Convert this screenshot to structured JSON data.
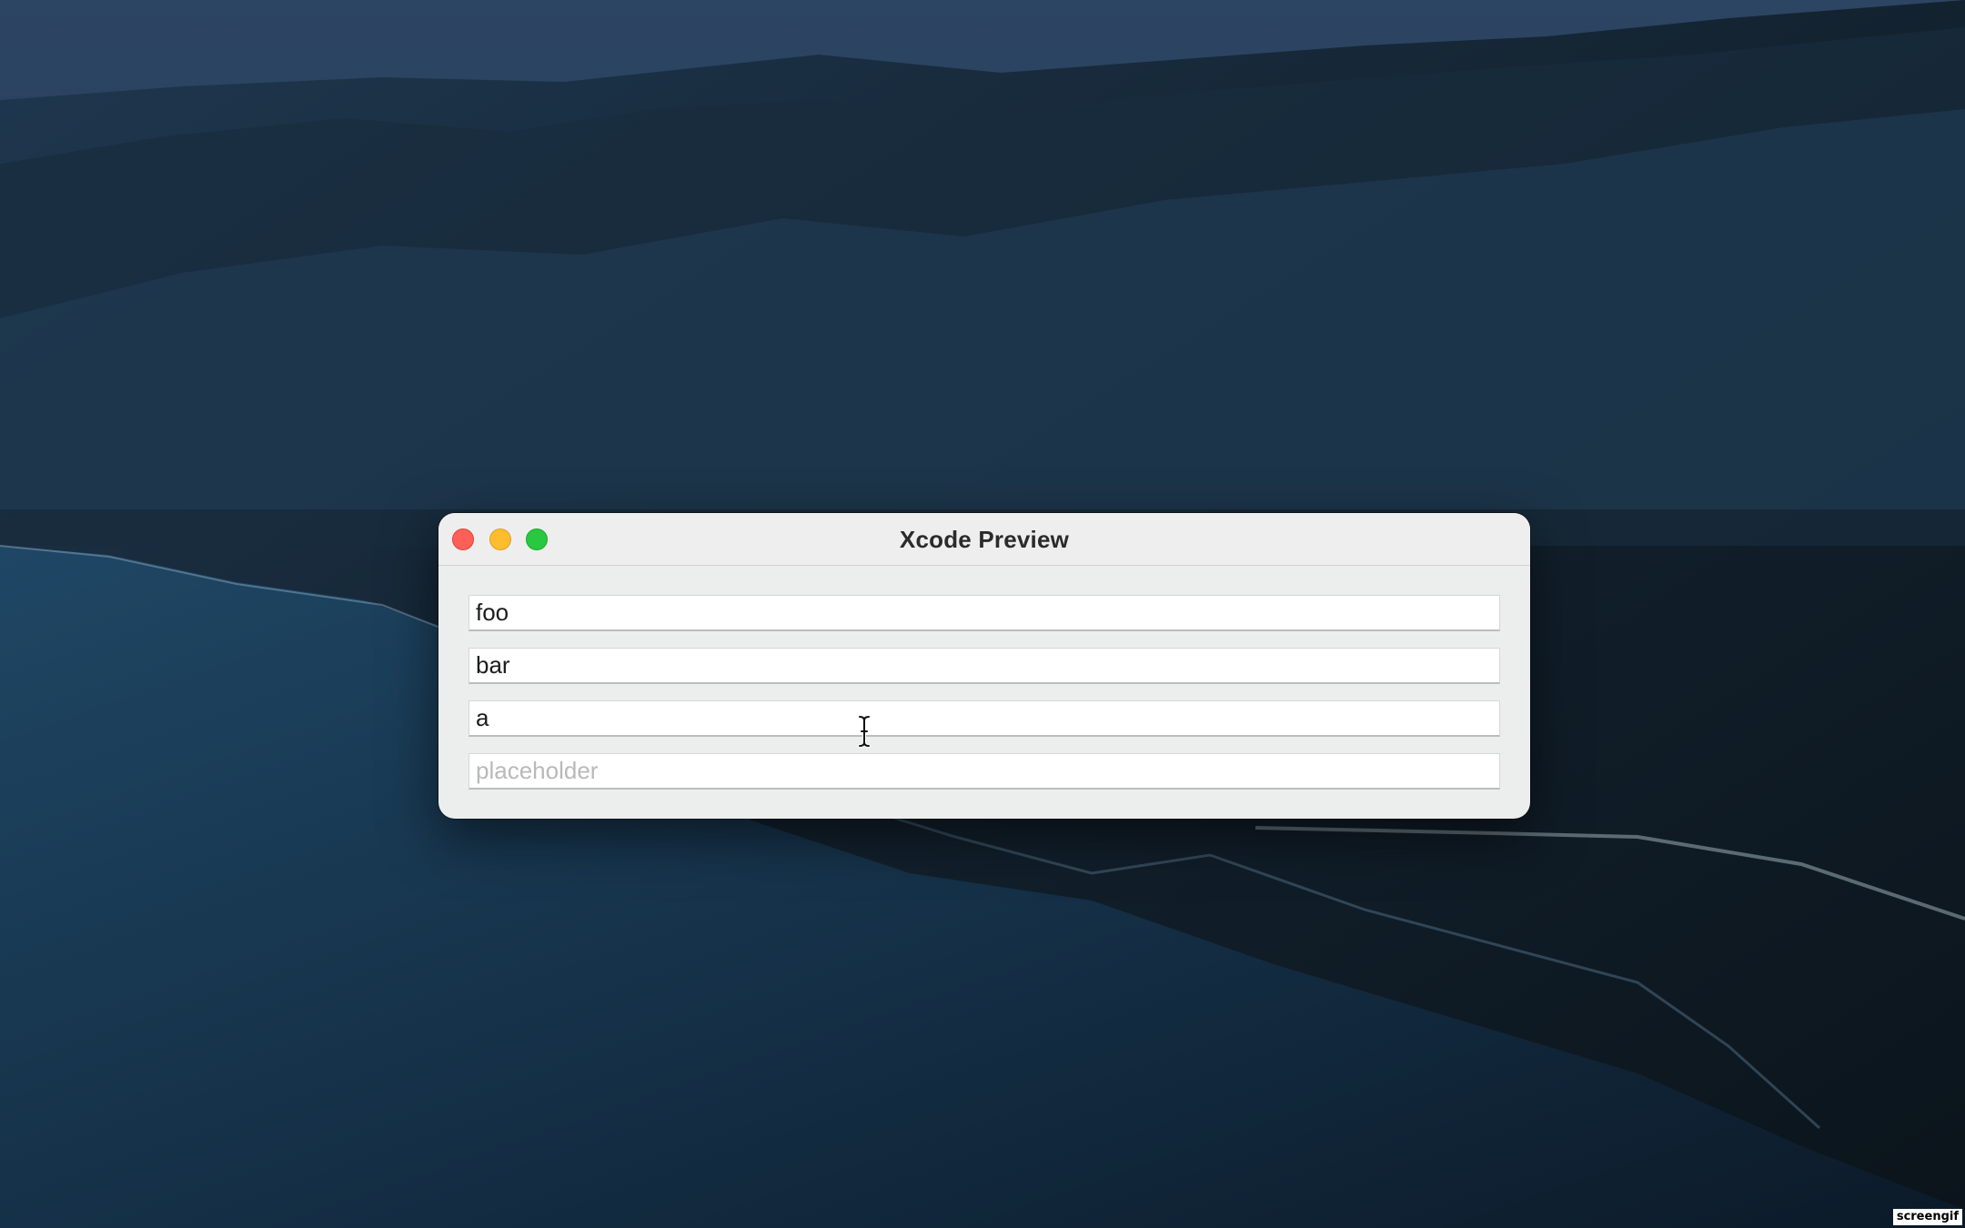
{
  "window": {
    "title": "Xcode Preview"
  },
  "fields": [
    {
      "value": "foo",
      "placeholder": ""
    },
    {
      "value": "bar",
      "placeholder": ""
    },
    {
      "value": "a",
      "placeholder": ""
    },
    {
      "value": "",
      "placeholder": "placeholder"
    }
  ],
  "watermark": {
    "text": "screengif"
  },
  "icons": {
    "close": "close-icon",
    "minimize": "minimize-icon",
    "zoom": "zoom-icon",
    "cursor": "text-cursor-icon"
  },
  "colors": {
    "close": "#fe5f57",
    "minimize": "#febc2e",
    "zoom": "#28c840"
  }
}
